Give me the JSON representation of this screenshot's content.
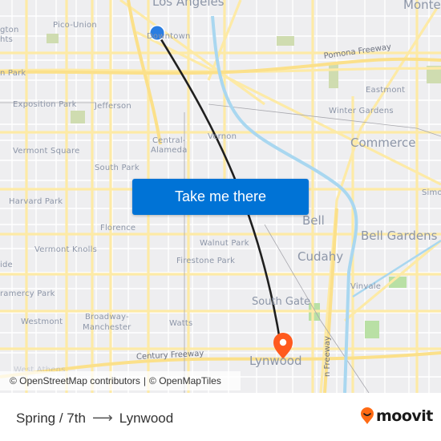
{
  "map": {
    "place_labels": [
      {
        "text": "Los Angeles",
        "size": "l"
      },
      {
        "text": "Monte",
        "size": "l"
      },
      {
        "text": "Pico-Union",
        "size": "s"
      },
      {
        "text": "gton",
        "size": "s"
      },
      {
        "text": "hts",
        "size": "s"
      },
      {
        "text": "Downtown",
        "size": "s"
      },
      {
        "text": "n Park",
        "size": "s"
      },
      {
        "text": "Exposition Park",
        "size": "s"
      },
      {
        "text": "Jefferson",
        "size": "s"
      },
      {
        "text": "Eastmont",
        "size": "s"
      },
      {
        "text": "Winter Gardens",
        "size": "s"
      },
      {
        "text": "Vermont Square",
        "size": "s"
      },
      {
        "text": "Central-",
        "size": "s"
      },
      {
        "text": "Alameda",
        "size": "s"
      },
      {
        "text": "Vernon",
        "size": "s"
      },
      {
        "text": "Commerce",
        "size": "l"
      },
      {
        "text": "South Park",
        "size": "s"
      },
      {
        "text": "Simo",
        "size": "s"
      },
      {
        "text": "Harvard Park",
        "size": "s"
      },
      {
        "text": "Bell",
        "size": "l"
      },
      {
        "text": "Bell Gardens",
        "size": "l"
      },
      {
        "text": "Florence",
        "size": "s"
      },
      {
        "text": "Walnut Park",
        "size": "s"
      },
      {
        "text": "Vermont Knolls",
        "size": "s"
      },
      {
        "text": "Firestone Park",
        "size": "s"
      },
      {
        "text": "Cudahy",
        "size": "l"
      },
      {
        "text": "ide",
        "size": "s"
      },
      {
        "text": "Vinvale",
        "size": "s"
      },
      {
        "text": "ramercy Park",
        "size": "s"
      },
      {
        "text": "South Gate",
        "size": "m"
      },
      {
        "text": "Westmont",
        "size": "s"
      },
      {
        "text": "Broadway-",
        "size": "s"
      },
      {
        "text": "Manchester",
        "size": "s"
      },
      {
        "text": "Watts",
        "size": "s"
      },
      {
        "text": "Lynwood",
        "size": "l"
      },
      {
        "text": "West Athens",
        "size": "s"
      }
    ],
    "road_labels": {
      "pomona": "Pomona Freeway",
      "century": "Century Freeway",
      "freeway_vertical": "n Freeway"
    },
    "origin_marker": {
      "icon": "origin-dot-icon",
      "color": "#2a7de1"
    },
    "destination_marker": {
      "icon": "destination-pin-icon",
      "color": "#ff5a1e"
    },
    "route_color": "#1f1f1f",
    "attribution": {
      "osm": "© OpenStreetMap contributors",
      "separator": "|",
      "omt": "© OpenMapTiles"
    }
  },
  "cta": {
    "label": "Take me there",
    "color": "#0073d6"
  },
  "route": {
    "from": "Spring / 7th",
    "arrow_icon": "arrow-right-icon",
    "arrow": "⟶",
    "to": "Lynwood"
  },
  "brand": {
    "name": "moovit",
    "color": "#ff6a13"
  }
}
